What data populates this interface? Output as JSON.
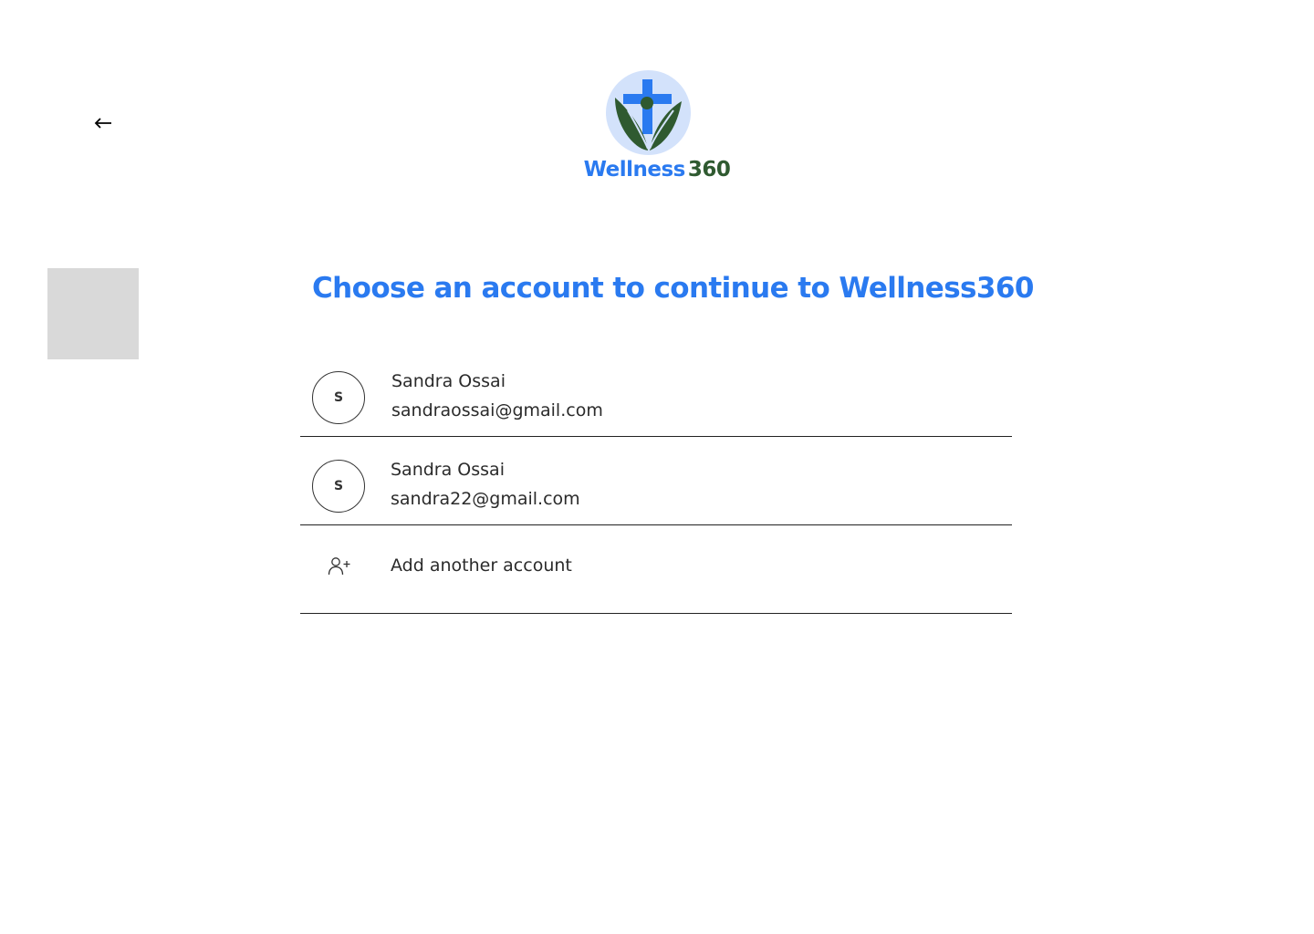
{
  "header": {
    "back_icon": "arrow-left-icon",
    "logo": {
      "icon": "cross-leaves-logo-icon",
      "word_part1": "Wellness",
      "word_part2": "360",
      "colors": {
        "blue": "#2a7af0",
        "green": "#2f5a30",
        "badge_bg": "#d3e2fb"
      }
    }
  },
  "main": {
    "title": "Choose an account to continue to Wellness360",
    "accounts": [
      {
        "initial": "S",
        "name": "Sandra Ossai",
        "email": "sandraossai@gmail.com"
      },
      {
        "initial": "S",
        "name": "Sandra Ossai",
        "email": "sandra22@gmail.com"
      }
    ],
    "add_account": {
      "icon": "user-plus-icon",
      "label": "Add another account"
    }
  },
  "colors": {
    "accent": "#2a7af0",
    "placeholder_gray": "#d9d9d9",
    "text": "#2b2b2b"
  }
}
